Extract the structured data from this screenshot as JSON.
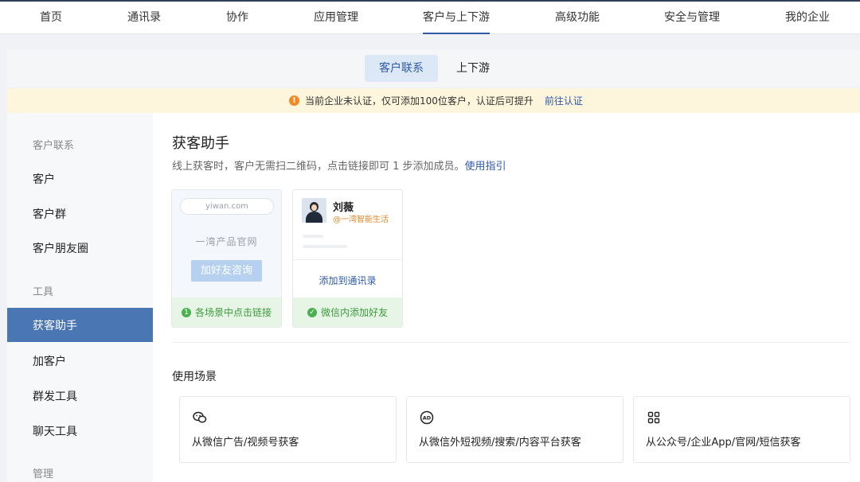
{
  "topnav": {
    "items": [
      "首页",
      "通讯录",
      "协作",
      "应用管理",
      "客户与上下游",
      "高级功能",
      "安全与管理",
      "我的企业"
    ],
    "active_index": 4
  },
  "tabs": {
    "active": "客户联系",
    "other": "上下游"
  },
  "notice": {
    "text": "当前企业未认证，仅可添加100位客户，认证后可提升",
    "link": "前往认证",
    "icon": "!"
  },
  "sidebar": {
    "section_contact": "客户联系",
    "customer": "客户",
    "customer_group": "客户群",
    "customer_moments": "客户朋友圈",
    "section_tools": "工具",
    "acquire_assistant": "获客助手",
    "add_customer": "加客户",
    "mass_send": "群发工具",
    "chat_tools": "聊天工具",
    "section_manage": "管理"
  },
  "main": {
    "title": "获客助手",
    "description": "线上获客时，客户无需扫二维码，点击链接即可 1 步添加成员。",
    "guide_link": "使用指引",
    "card1": {
      "url": "yiwan.com",
      "site_name": "一湾产品官网",
      "button": "加好友咨询",
      "footer": "各场景中点击链接",
      "footer_icon": "1"
    },
    "card2": {
      "name": "刘薇",
      "company": "@一湾智能生活",
      "action": "添加到通讯录",
      "footer": "微信内添加好友",
      "footer_icon": "✓"
    },
    "scenes_title": "使用场景",
    "scenes": [
      {
        "label": "从微信广告/视频号获客",
        "icon": "wechat-icon"
      },
      {
        "label": "从微信外短视频/搜索/内容平台获客",
        "icon": "ad-icon"
      },
      {
        "label": "从公众号/企业App/官网/短信获客",
        "icon": "apps-grid-icon"
      }
    ]
  },
  "colors": {
    "accent": "#2e5aa8",
    "sidebar_active": "#4a76b3",
    "notice_bg": "#fdf6dc",
    "success": "#3c9a3c",
    "warning": "#f08a24"
  }
}
